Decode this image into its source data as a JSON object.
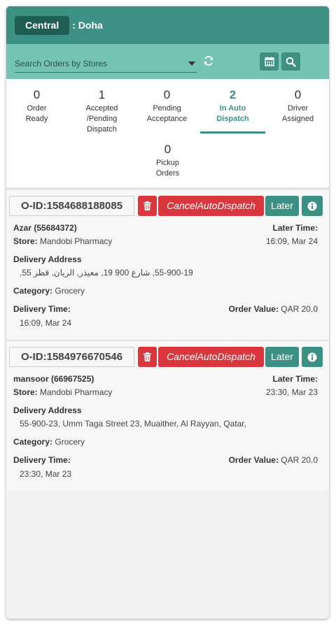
{
  "header": {
    "city_label": "Central",
    "city_name": ": Doha"
  },
  "search": {
    "placeholder": "Search Orders by Stores"
  },
  "icons": {
    "refresh": "refresh-icon",
    "calendar": "calendar-icon",
    "search": "search-icon",
    "trash": "trash-icon",
    "info": "info-icon"
  },
  "tabs": [
    {
      "count": "0",
      "label1": "Order",
      "label2": "Ready",
      "label3": ""
    },
    {
      "count": "1",
      "label1": "Accepted",
      "label2": "/Pending",
      "label3": "Dispatch"
    },
    {
      "count": "0",
      "label1": "Pending",
      "label2": "Acceptance",
      "label3": ""
    },
    {
      "count": "2",
      "label1": "In Auto",
      "label2": "Dispatch",
      "label3": ""
    },
    {
      "count": "0",
      "label1": "Driver",
      "label2": "Assigned",
      "label3": ""
    },
    {
      "count": "0",
      "label1": "Pickup",
      "label2": "Orders",
      "label3": ""
    }
  ],
  "labels": {
    "later_time": "Later Time:",
    "store": "Store:",
    "delivery_address": "Delivery Address",
    "category": "Category:",
    "delivery_time": "Delivery Time:",
    "order_value": "Order Value:",
    "cancel_btn": "CancelAutoDispatch",
    "later_btn": "Later"
  },
  "orders": [
    {
      "oid": "O-ID:1584688188085",
      "customer": "Azar (55684372)",
      "store": "Mandobi Pharmacy",
      "later_time": "16:09, Mar 24",
      "address": "55-900-19, شارع 900 19, معيذر, الريان, قطر 55,",
      "category": "Grocery",
      "delivery_time": "16:09, Mar 24",
      "order_value": "QAR 20.0"
    },
    {
      "oid": "O-ID:1584976670546",
      "customer": "mansoor (66967525)",
      "store": "Mandobi Pharmacy",
      "later_time": "23:30, Mar 23",
      "address": "55-900-23, Umm Taga Street 23, Muaither, Al Rayyan, Qatar,",
      "category": "Grocery",
      "delivery_time": "23:30, Mar 23",
      "order_value": "QAR 20.0"
    }
  ],
  "colors": {
    "primary": "#3d9184",
    "header": "#3d9184",
    "searchbar": "#74c3b5",
    "danger": "#d9363e",
    "badge": "#1f5d55"
  }
}
